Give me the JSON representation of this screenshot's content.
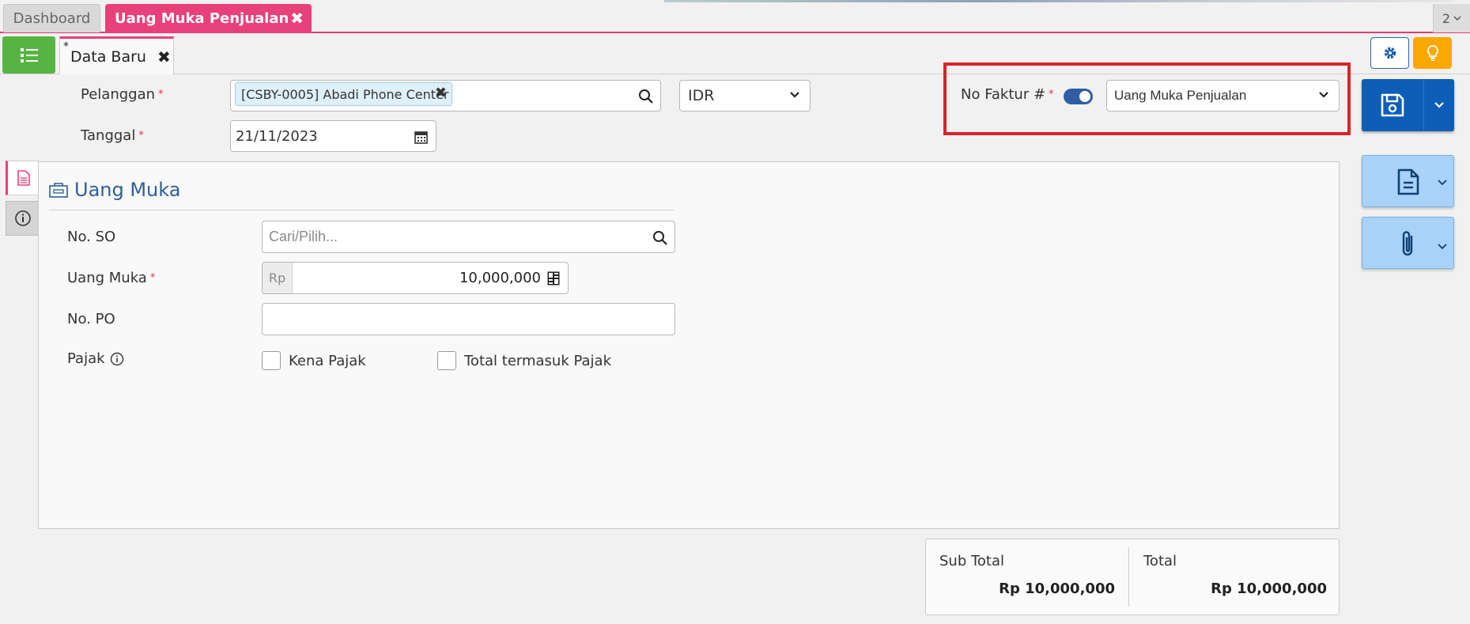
{
  "tabs": {
    "dashboard": "Dashboard",
    "active": "Uang Muka Penjualan",
    "count": "2"
  },
  "subtab": {
    "marker": "*",
    "label": "Data Baru"
  },
  "header": {
    "pelanggan_label": "Pelanggan",
    "pelanggan_value": "[CSBY-0005] Abadi Phone Center",
    "currency": "IDR",
    "tanggal_label": "Tanggal",
    "tanggal_value": "21/11/2023",
    "no_faktur_label": "No Faktur #",
    "no_faktur_toggle_on": true,
    "no_faktur_type": "Uang Muka Penjualan",
    "required_mark": "*"
  },
  "panel": {
    "title": "Uang Muka",
    "no_so_label": "No. SO",
    "no_so_placeholder": "Cari/Pilih...",
    "uang_muka_label": "Uang Muka",
    "currency_prefix": "Rp",
    "uang_muka_value": "10,000,000",
    "no_po_label": "No. PO",
    "no_po_value": "",
    "pajak_label": "Pajak",
    "kena_pajak_label": "Kena Pajak",
    "total_termasuk_pajak_label": "Total termasuk Pajak"
  },
  "totals": {
    "sub_total_label": "Sub Total",
    "sub_total_value": "Rp 10,000,000",
    "total_label": "Total",
    "total_value": "Rp 10,000,000"
  },
  "colors": {
    "accent_pink": "#e8407a",
    "primary_blue": "#0e5eb8",
    "green": "#58b442",
    "orange": "#f8a800",
    "highlight_red": "#d8232a"
  }
}
